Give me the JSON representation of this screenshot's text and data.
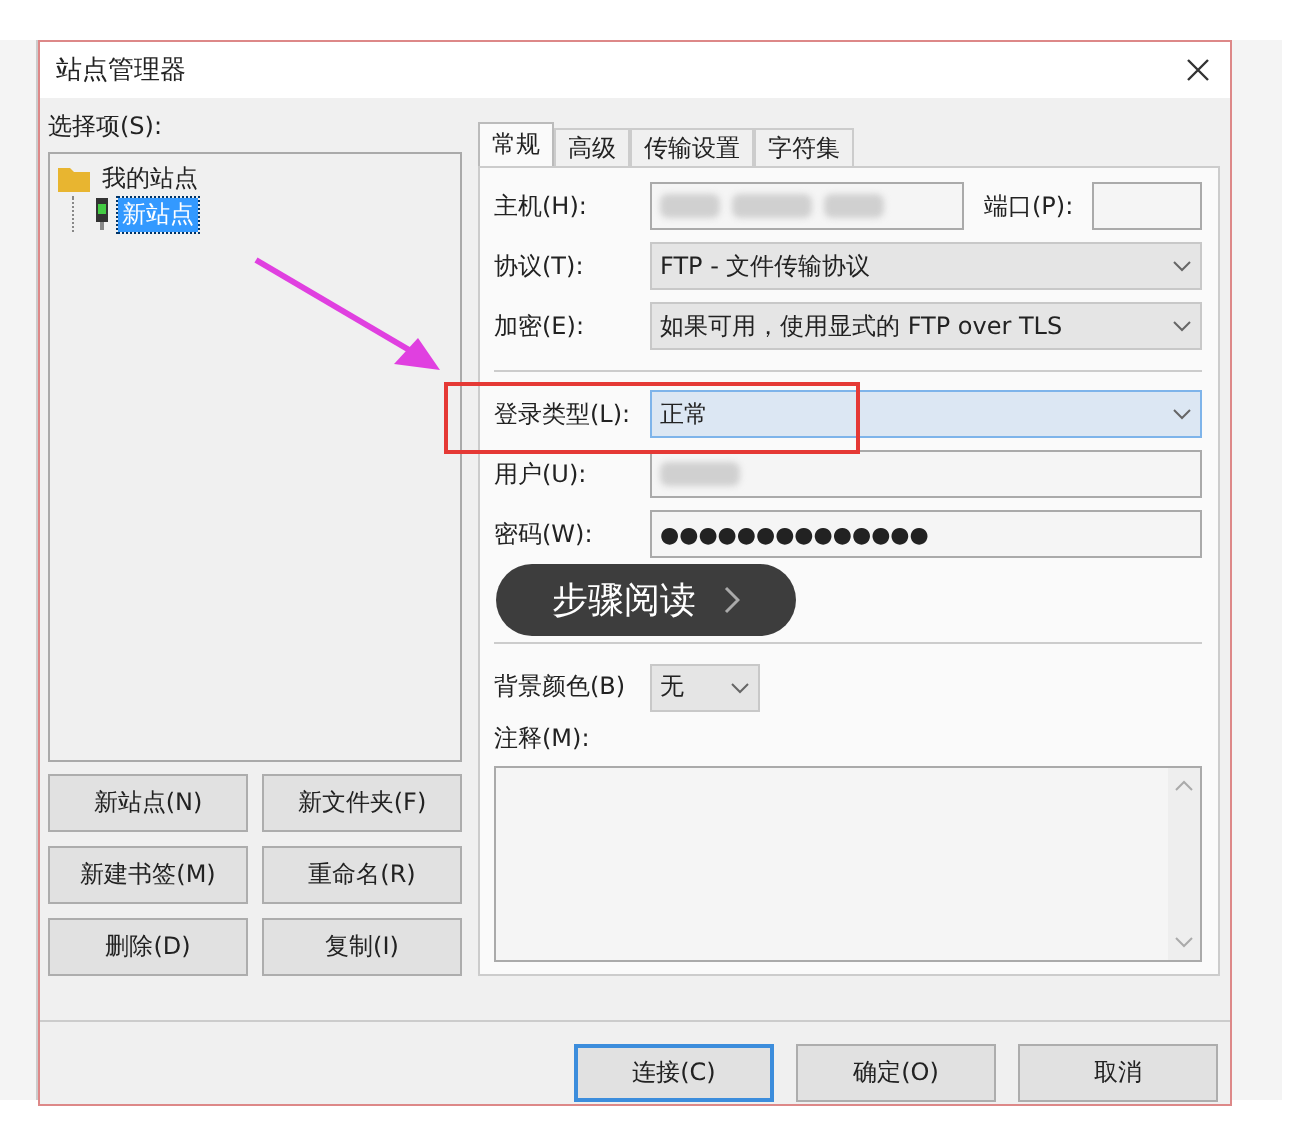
{
  "window": {
    "title": "站点管理器"
  },
  "site_tree": {
    "label": "选择项(S):",
    "items": [
      {
        "label": "我的站点",
        "kind": "folder",
        "selected": false,
        "children": [
          {
            "label": "新站点",
            "kind": "site",
            "selected": true
          }
        ]
      }
    ]
  },
  "site_buttons": [
    "新站点(N)",
    "新文件夹(F)",
    "新建书签(M)",
    "重命名(R)",
    "删除(D)",
    "复制(I)"
  ],
  "tabs": [
    {
      "label": "常规",
      "selected": true
    },
    {
      "label": "高级",
      "selected": false
    },
    {
      "label": "传输设置",
      "selected": false
    },
    {
      "label": "字符集",
      "selected": false
    }
  ],
  "general": {
    "host": {
      "label": "主机(H):"
    },
    "port": {
      "label": "端口(P):"
    },
    "protocol": {
      "label": "协议(T):",
      "value": "FTP - 文件传输协议",
      "focused": false
    },
    "encryption": {
      "label": "加密(E):",
      "value": "如果可用，使用显式的 FTP over TLS",
      "focused": false
    },
    "logon_type": {
      "label": "登录类型(L):",
      "value": "正常",
      "focused": true
    },
    "user": {
      "label": "用户(U):"
    },
    "password": {
      "label": "密码(W):",
      "value": "●●●●●●●●●●●●●●"
    },
    "background_color": {
      "label": "背景颜色(B)",
      "value": "无"
    },
    "comments": {
      "label": "注释(M):"
    }
  },
  "dialog_buttons": [
    {
      "label": "连接(C)",
      "default": true
    },
    {
      "label": "确定(O)",
      "default": false
    },
    {
      "label": "取消",
      "default": false
    }
  ],
  "overlay": {
    "label": "步骤阅读"
  }
}
